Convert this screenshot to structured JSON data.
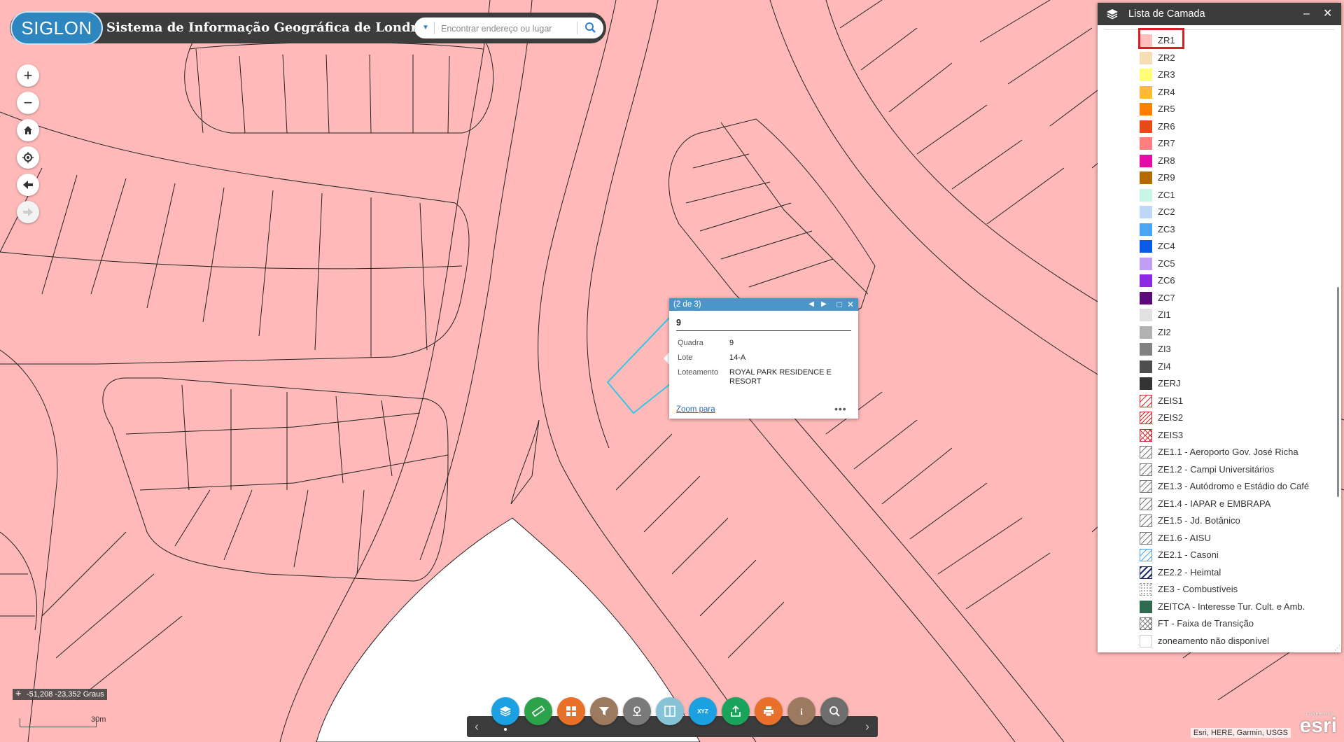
{
  "app": {
    "logo_text": "SIGLON",
    "title": "Sistema de Informação Geográfica de Londrina"
  },
  "search": {
    "placeholder": "Encontrar endereço ou lugar"
  },
  "map_tools": [
    "zoom-in",
    "zoom-out",
    "home",
    "my-location",
    "previous-extent",
    "next-extent"
  ],
  "map_tool_symbols": {
    "zoom_in": "+",
    "zoom_out": "−"
  },
  "coordinates": "-51,208 -23,352 Graus",
  "scale_label": "30m",
  "attribution": "Esri, HERE, Garmin, USGS",
  "esri_logo": "esri",
  "esri_powered": "POWERED BY",
  "popup": {
    "counter": "(2 de 3)",
    "title": "9",
    "fields": [
      {
        "key": "Quadra",
        "value": "9"
      },
      {
        "key": "Lote",
        "value": "14-A"
      },
      {
        "key": "Loteamento",
        "value": "ROYAL PARK RESIDENCE E RESORT"
      }
    ],
    "zoom_link": "Zoom para",
    "more": "•••",
    "controls": {
      "prev": "◀",
      "next": "▶",
      "maximize": "□",
      "close": "✕"
    }
  },
  "layer_panel": {
    "title": "Lista de Camada",
    "minimize": "–",
    "close": "✕",
    "items": [
      {
        "label": "ZR1",
        "color": "#ffbebe",
        "pattern": "solid"
      },
      {
        "label": "ZR2",
        "color": "#f5deb3",
        "pattern": "solid"
      },
      {
        "label": "ZR3",
        "color": "#ffff73",
        "pattern": "solid"
      },
      {
        "label": "ZR4",
        "color": "#ffb935",
        "pattern": "solid"
      },
      {
        "label": "ZR5",
        "color": "#ff7f00",
        "pattern": "solid"
      },
      {
        "label": "ZR6",
        "color": "#e64a19",
        "pattern": "solid"
      },
      {
        "label": "ZR7",
        "color": "#ff7f7f",
        "pattern": "solid"
      },
      {
        "label": "ZR8",
        "color": "#e60aa8",
        "pattern": "solid"
      },
      {
        "label": "ZR9",
        "color": "#b36b00",
        "pattern": "solid"
      },
      {
        "label": "ZC1",
        "color": "#c8f5e6",
        "pattern": "solid"
      },
      {
        "label": "ZC2",
        "color": "#bed7f5",
        "pattern": "solid"
      },
      {
        "label": "ZC3",
        "color": "#4aa6f0",
        "pattern": "solid"
      },
      {
        "label": "ZC4",
        "color": "#0a5ae6",
        "pattern": "solid"
      },
      {
        "label": "ZC5",
        "color": "#c0a0f5",
        "pattern": "solid"
      },
      {
        "label": "ZC6",
        "color": "#8a2be2",
        "pattern": "solid"
      },
      {
        "label": "ZC7",
        "color": "#5a0a7a",
        "pattern": "solid"
      },
      {
        "label": "ZI1",
        "color": "#e1e1e1",
        "pattern": "solid"
      },
      {
        "label": "ZI2",
        "color": "#b2b2b2",
        "pattern": "solid"
      },
      {
        "label": "ZI3",
        "color": "#828282",
        "pattern": "solid"
      },
      {
        "label": "ZI4",
        "color": "#4e4e4e",
        "pattern": "solid"
      },
      {
        "label": "ZERJ",
        "color": "#343434",
        "pattern": "solid"
      },
      {
        "label": "ZEIS1",
        "color": "#d62828",
        "pattern": "hatch"
      },
      {
        "label": "ZEIS2",
        "color": "#d62828",
        "pattern": "hatch-dense"
      },
      {
        "label": "ZEIS3",
        "color": "#d62828",
        "pattern": "cross"
      },
      {
        "label": "ZE1.1 - Aeroporto Gov. José Richa",
        "color": "#777777",
        "pattern": "hatch"
      },
      {
        "label": "ZE1.2 - Campi Universitários",
        "color": "#777777",
        "pattern": "hatch"
      },
      {
        "label": "ZE1.3 - Autódromo e Estádio do Café",
        "color": "#777777",
        "pattern": "hatch"
      },
      {
        "label": "ZE1.4 - IAPAR e EMBRAPA",
        "color": "#777777",
        "pattern": "hatch"
      },
      {
        "label": "ZE1.5 - Jd. Botânico",
        "color": "#777777",
        "pattern": "hatch"
      },
      {
        "label": "ZE1.6 - AISU",
        "color": "#777777",
        "pattern": "hatch"
      },
      {
        "label": "ZE2.1 - Casoni",
        "color": "#4aa6f0",
        "pattern": "hatch"
      },
      {
        "label": "ZE2.2 - Heimtal",
        "color": "#1a2a6a",
        "pattern": "hatch-bold"
      },
      {
        "label": "ZE3 - Combustíveis",
        "color": "#999999",
        "pattern": "dots"
      },
      {
        "label": "ZEITCA - Interesse Tur. Cult. e Amb.",
        "color": "#2e6b4f",
        "pattern": "solid"
      },
      {
        "label": "FT - Faixa de Transição",
        "color": "#777777",
        "pattern": "cross-dots"
      },
      {
        "label": "zoneamento não disponível",
        "color": "#ffffff",
        "pattern": "empty"
      }
    ]
  },
  "bottom_toolbar": {
    "buttons": [
      {
        "name": "layer-list-icon",
        "color": "#1ba1e2"
      },
      {
        "name": "measure-icon",
        "color": "#2ca24a"
      },
      {
        "name": "basemap-gallery-icon",
        "color": "#e8702a"
      },
      {
        "name": "filter-icon",
        "color": "#9c7a5f"
      },
      {
        "name": "location-icon",
        "color": "#7a7a7a"
      },
      {
        "name": "swipe-icon",
        "color": "#86c3d6"
      },
      {
        "name": "xyz-coordinate-icon",
        "color": "#1ba1e2"
      },
      {
        "name": "share-icon",
        "color": "#1aa35b"
      },
      {
        "name": "print-icon",
        "color": "#e8702a"
      },
      {
        "name": "about-icon",
        "color": "#9c7a5f"
      },
      {
        "name": "query-icon",
        "color": "#6e6e6e"
      }
    ],
    "xyz_label": "XYZ"
  }
}
